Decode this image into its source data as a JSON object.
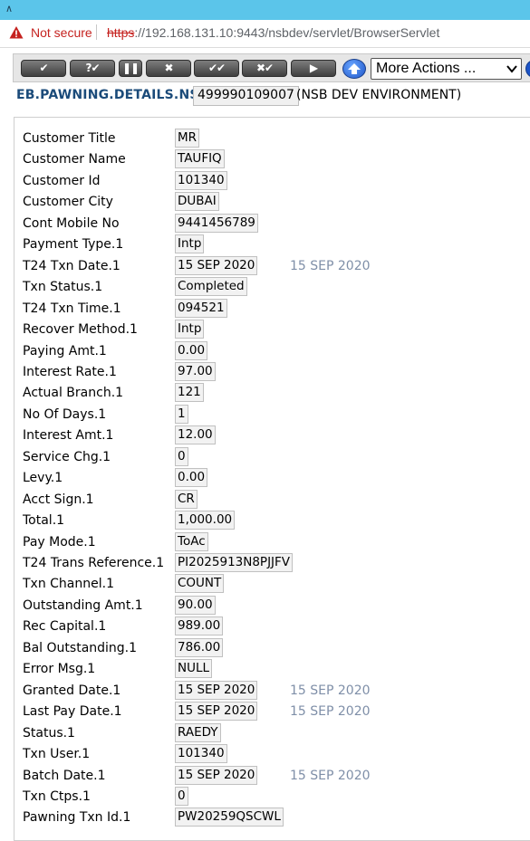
{
  "browser": {
    "security_label": "Not secure",
    "url_scheme": "https",
    "url_rest": "://192.168.131.10:9443/nsbdev/servlet/BrowserServlet"
  },
  "toolbar": {
    "buttons": [
      {
        "label": "✔",
        "icon": "commit-icon"
      },
      {
        "label": "?✔",
        "icon": "validate-icon"
      },
      {
        "label": "❚❚",
        "icon": "hold-icon"
      },
      {
        "label": "✖",
        "icon": "delete-icon"
      },
      {
        "label": "✔✔",
        "icon": "authorise-icon"
      },
      {
        "label": "✖✔",
        "icon": "reverse-icon"
      },
      {
        "label": "▶",
        "icon": "next-icon"
      }
    ],
    "more_actions": "More Actions ..."
  },
  "app": {
    "name": "EB.PAWNING.DETAILS.NSB",
    "record_id": "499990109007",
    "environment": "(NSB DEV ENVIRONMENT)"
  },
  "fields": [
    {
      "label": "Customer Title",
      "value": "MR",
      "extra": ""
    },
    {
      "label": "Customer Name",
      "value": "TAUFIQ",
      "extra": ""
    },
    {
      "label": "Customer Id",
      "value": "101340",
      "extra": ""
    },
    {
      "label": "Customer City",
      "value": "DUBAI",
      "extra": ""
    },
    {
      "label": "Cont Mobile No",
      "value": "9441456789",
      "extra": ""
    },
    {
      "label": "Payment Type.1",
      "value": "Intp",
      "extra": ""
    },
    {
      "label": "T24 Txn Date.1",
      "value": "15 SEP 2020",
      "extra": "15 SEP 2020"
    },
    {
      "label": "Txn Status.1",
      "value": "Completed",
      "extra": ""
    },
    {
      "label": "T24 Txn Time.1",
      "value": "094521",
      "extra": ""
    },
    {
      "label": "Recover Method.1",
      "value": "Intp",
      "extra": ""
    },
    {
      "label": "Paying Amt.1",
      "value": "0.00",
      "extra": ""
    },
    {
      "label": "Interest Rate.1",
      "value": "97.00",
      "extra": ""
    },
    {
      "label": "Actual Branch.1",
      "value": "121",
      "extra": ""
    },
    {
      "label": "No Of Days.1",
      "value": "1",
      "extra": ""
    },
    {
      "label": "Interest Amt.1",
      "value": "12.00",
      "extra": ""
    },
    {
      "label": "Service Chg.1",
      "value": "0",
      "extra": ""
    },
    {
      "label": "Levy.1",
      "value": "0.00",
      "extra": ""
    },
    {
      "label": "Acct Sign.1",
      "value": "CR",
      "extra": ""
    },
    {
      "label": "Total.1",
      "value": "1,000.00",
      "extra": ""
    },
    {
      "label": "Pay Mode.1",
      "value": "ToAc",
      "extra": ""
    },
    {
      "label": "T24 Trans Reference.1",
      "value": "PI2025913N8PJJFV",
      "extra": ""
    },
    {
      "label": "Txn Channel.1",
      "value": "COUNT",
      "extra": ""
    },
    {
      "label": "Outstanding Amt.1",
      "value": "90.00",
      "extra": ""
    },
    {
      "label": "Rec Capital.1",
      "value": "989.00",
      "extra": ""
    },
    {
      "label": "Bal Outstanding.1",
      "value": "786.00",
      "extra": ""
    },
    {
      "label": "Error Msg.1",
      "value": "NULL",
      "extra": ""
    },
    {
      "label": "Granted Date.1",
      "value": "15 SEP 2020",
      "extra": "15 SEP 2020"
    },
    {
      "label": "Last Pay Date.1",
      "value": "15 SEP 2020",
      "extra": "15 SEP 2020"
    },
    {
      "label": "Status.1",
      "value": "RAEDY",
      "extra": ""
    },
    {
      "label": "Txn User.1",
      "value": "101340",
      "extra": ""
    },
    {
      "label": "Batch Date.1",
      "value": "15 SEP 2020",
      "extra": "15 SEP 2020"
    },
    {
      "label": "Txn Ctps.1",
      "value": "0",
      "extra": ""
    },
    {
      "label": "Pawning Txn Id.1",
      "value": "PW20259QSCWL",
      "extra": ""
    }
  ]
}
